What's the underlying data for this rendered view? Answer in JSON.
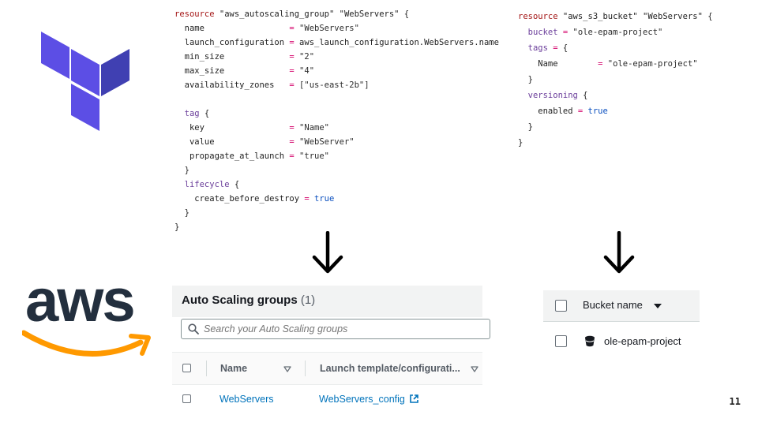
{
  "terraform_asg_code": {
    "l1": {
      "kw": "resource",
      "rest": " \"aws_autoscaling_group\" \"WebServers\" {"
    },
    "l2": {
      "key": "  name                 ",
      "op": "=",
      "val": " \"WebServers\""
    },
    "l3": {
      "key": "  launch_configuration ",
      "op": "=",
      "val": " aws_launch_configuration.WebServers.name"
    },
    "l4": {
      "key": "  min_size             ",
      "op": "=",
      "val": " \"2\""
    },
    "l5": {
      "key": "  max_size             ",
      "op": "=",
      "val": " \"4\""
    },
    "l6": {
      "key": "  availability_zones   ",
      "op": "=",
      "val": " [\"us-east-2b\"]"
    },
    "l8": {
      "blk": "  tag",
      "rest": " {"
    },
    "l9": {
      "key": "   key                 ",
      "op": "=",
      "val": " \"Name\""
    },
    "l10": {
      "key": "   value               ",
      "op": "=",
      "val": " \"WebServer\""
    },
    "l11": {
      "key": "   propagate_at_launch ",
      "op": "=",
      "val": " \"true\""
    },
    "l12": "  }",
    "l13": {
      "blk": "  lifecycle",
      "rest": " {"
    },
    "l14": {
      "key": "    create_before_destroy ",
      "op": "=",
      "val": " true"
    },
    "l15": "  }",
    "l16": "}"
  },
  "terraform_s3_code": {
    "l1": {
      "kw": "resource",
      "rest": " \"aws_s3_bucket\" \"WebServers\" {"
    },
    "l2": {
      "blk": "  bucket",
      "op": " =",
      "val": " \"ole-epam-project\""
    },
    "l3": {
      "blk": "  tags",
      "op": " =",
      "val": " {"
    },
    "l4": {
      "key": "    Name        ",
      "op": "=",
      "val": " \"ole-epam-project\""
    },
    "l5": "  }",
    "l6": {
      "blk": "  versioning",
      "rest": " {"
    },
    "l7": {
      "key": "    enabled ",
      "op": "=",
      "val": " true"
    },
    "l8": "  }",
    "l9": "}"
  },
  "asg_console": {
    "title": "Auto Scaling groups",
    "count": "(1)",
    "search_placeholder": "Search your Auto Scaling groups",
    "columns": [
      "Name",
      "Launch template/configurati..."
    ],
    "row": {
      "name": "WebServers",
      "launch": "WebServers_config"
    }
  },
  "s3_console": {
    "column": "Bucket name",
    "bucket": "ole-epam-project"
  },
  "logos": {
    "terraform": "terraform-logo",
    "aws_text": "aws",
    "aws_color_dark": "#232f3e",
    "aws_color_orange": "#ff9900",
    "terraform_color": "#5c4ee5"
  },
  "page_number": "11"
}
